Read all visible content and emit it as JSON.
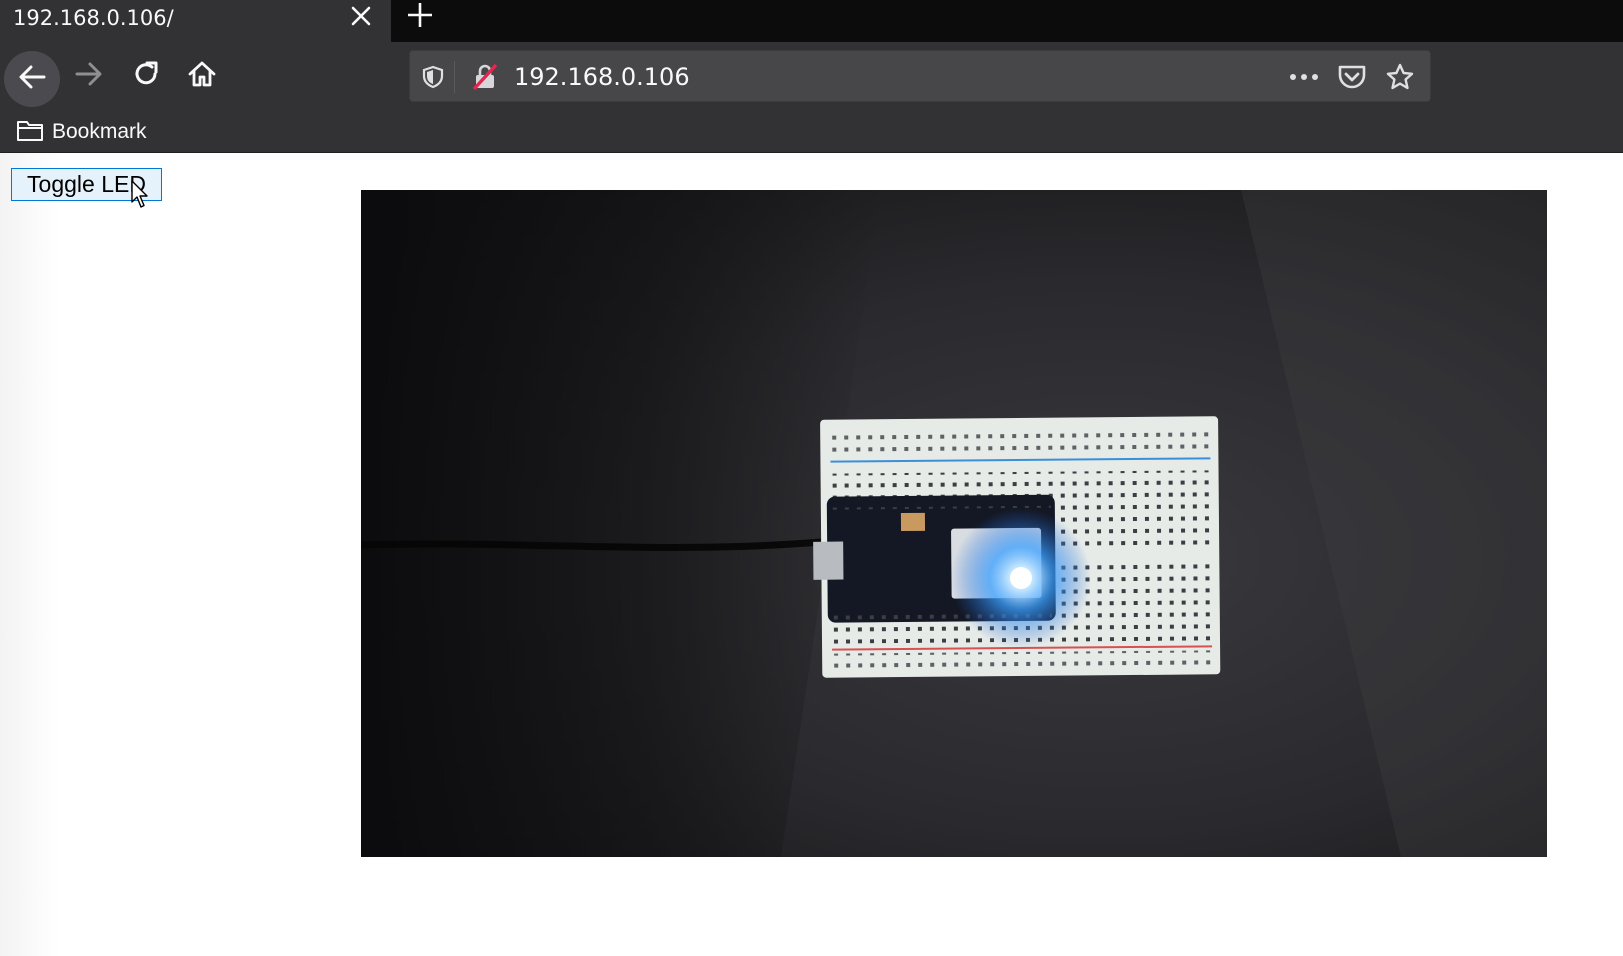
{
  "tab": {
    "title": "192.168.0.106/"
  },
  "address_bar": {
    "url": "192.168.0.106"
  },
  "bookmarks": {
    "folder_label": "Bookmark"
  },
  "page": {
    "toggle_button_label": "Toggle LED"
  },
  "icons": {
    "tab_close": "close-icon",
    "new_tab": "plus-icon",
    "back": "arrow-left-icon",
    "forward": "arrow-right-icon",
    "reload": "reload-icon",
    "home": "home-icon",
    "tracking_protection": "shield-icon",
    "insecure_connection": "broken-lock-icon",
    "page_actions": "more-horizontal-icon",
    "pocket": "pocket-icon",
    "bookmark_star": "star-icon",
    "bookmark_folder": "folder-icon",
    "mouse_cursor": "pointer-cursor-icon"
  },
  "colors": {
    "toolbar_bg": "#323234",
    "tab_strip_bg": "#0c0c0d",
    "urlbar_bg": "#474749",
    "button_border": "#0078d7",
    "button_bg": "#e5f1fb",
    "led_glow": "#3aa0ff"
  }
}
